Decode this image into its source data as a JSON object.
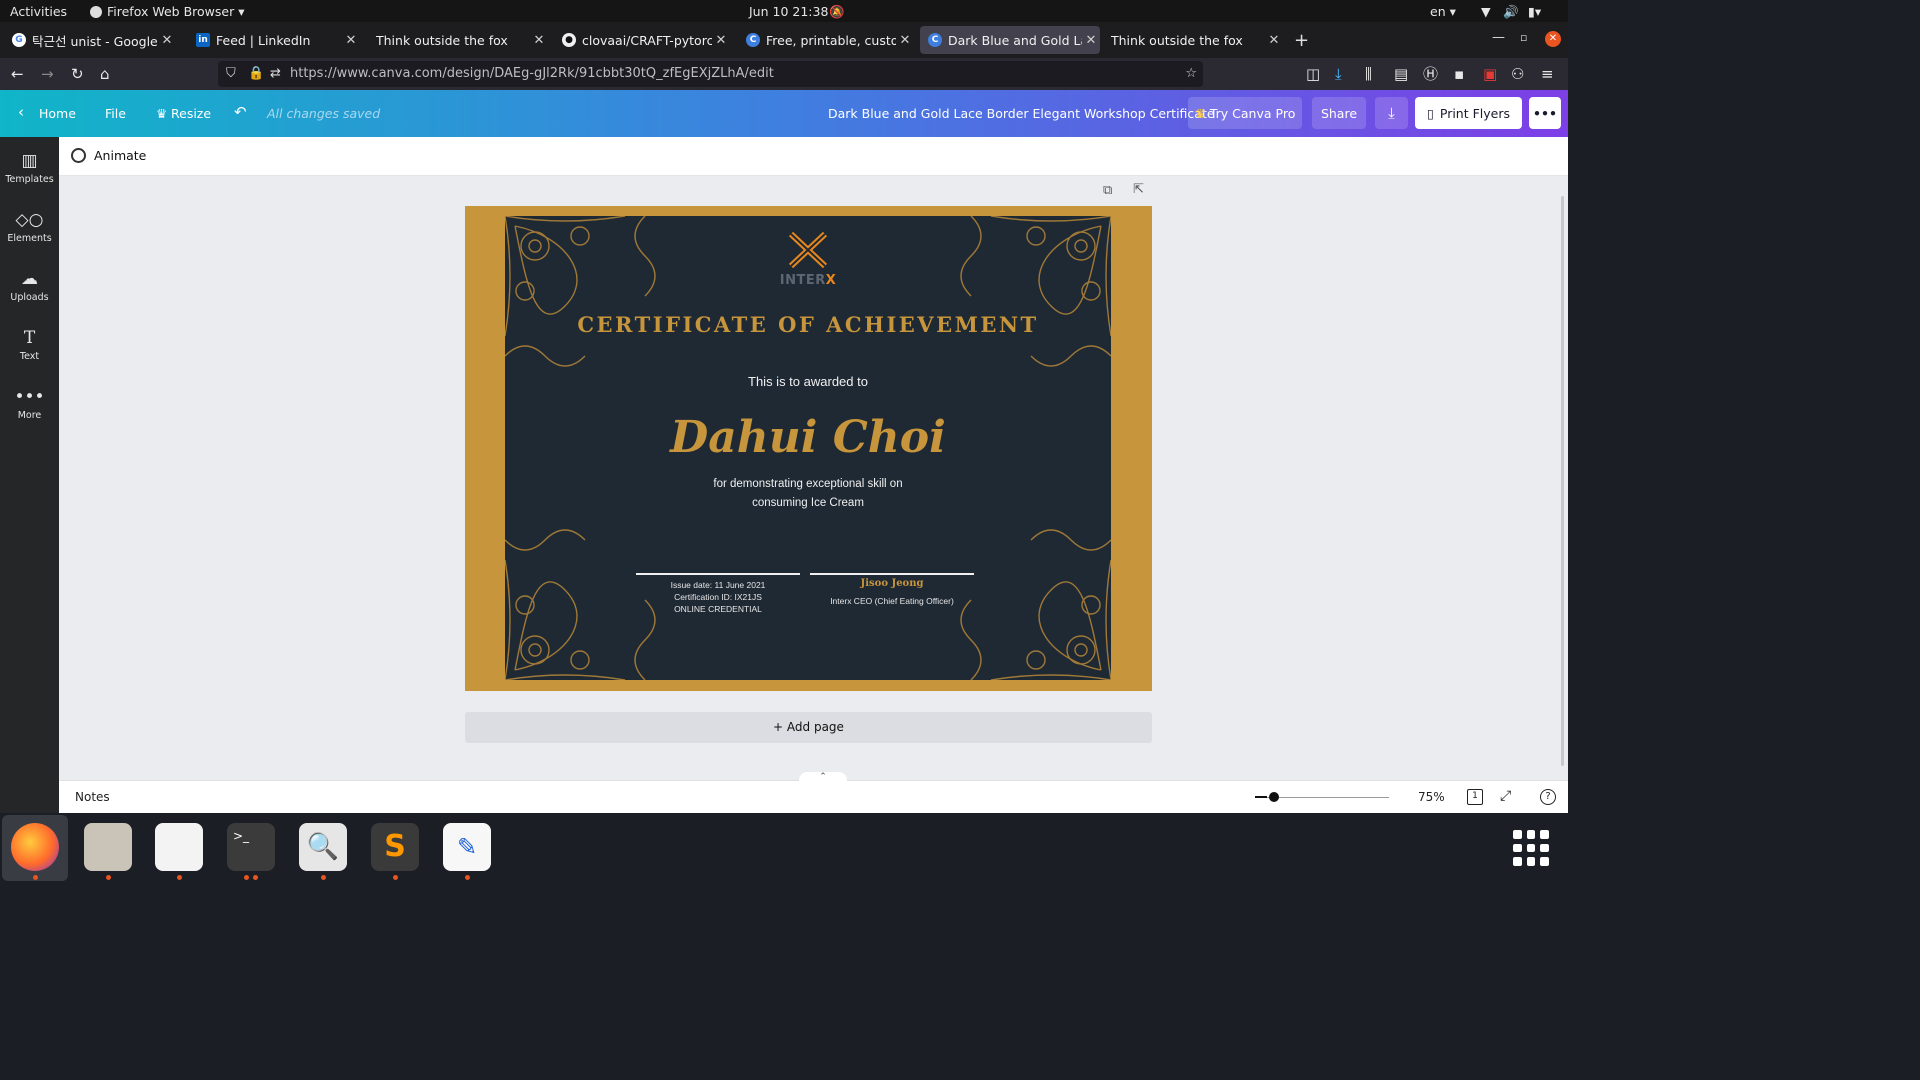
{
  "system_bar": {
    "activities": "Activities",
    "app_menu": "Firefox Web Browser ▾",
    "datetime": "Jun 10  21:38",
    "lang": "en ▾"
  },
  "tabs": [
    {
      "title": "탁근선 unist - Google Sear",
      "icon": "google-icon"
    },
    {
      "title": "Feed | LinkedIn",
      "icon": "linkedin-icon"
    },
    {
      "title": "Think outside the fox",
      "icon": "none"
    },
    {
      "title": "clovaai/CRAFT-pytorch: C",
      "icon": "github-icon"
    },
    {
      "title": "Free, printable, customiz",
      "icon": "canva-icon"
    },
    {
      "title": "Dark Blue and Gold Lace",
      "icon": "canva-icon",
      "active": true
    },
    {
      "title": "Think outside the fox",
      "icon": "none"
    }
  ],
  "url": "https://www.canva.com/design/DAEg-gJl2Rk/91cbbt30tQ_zfEgEXjZLhA/edit",
  "canva_header": {
    "home": "Home",
    "file": "File",
    "resize": "Resize",
    "saved": "All changes saved",
    "doc_title": "Dark Blue and Gold Lace Border Elegant Workshop Certificate",
    "try_pro": "Try Canva Pro",
    "share": "Share",
    "print": "Print Flyers"
  },
  "side_panel": [
    "Templates",
    "Elements",
    "Uploads",
    "Text",
    "More"
  ],
  "animate": "Animate",
  "certificate": {
    "logo_text_a": "INTER",
    "logo_text_b": "X",
    "heading": "CERTIFICATE OF ACHIEVEMENT",
    "intro": "This is to awarded to",
    "name": "Dahui Choi",
    "reason_1": "for demonstrating exceptional skill on",
    "reason_2": "consuming Ice Cream",
    "issue_date": "Issue date: 11 June 2021",
    "cert_id": "Certification ID: IX21JS",
    "credential": "ONLINE CREDENTIAL",
    "signer": "Jisoo Jeong",
    "signer_title": "Interx CEO (Chief Eating Officer)"
  },
  "add_page": "+ Add page",
  "footer": {
    "notes": "Notes",
    "zoom": "75%",
    "page_num": "1",
    "zoom_level": 0.14
  },
  "colors": {
    "gold": "#c7953b",
    "navy": "#1f2933",
    "accent_orange": "#e8871e"
  }
}
